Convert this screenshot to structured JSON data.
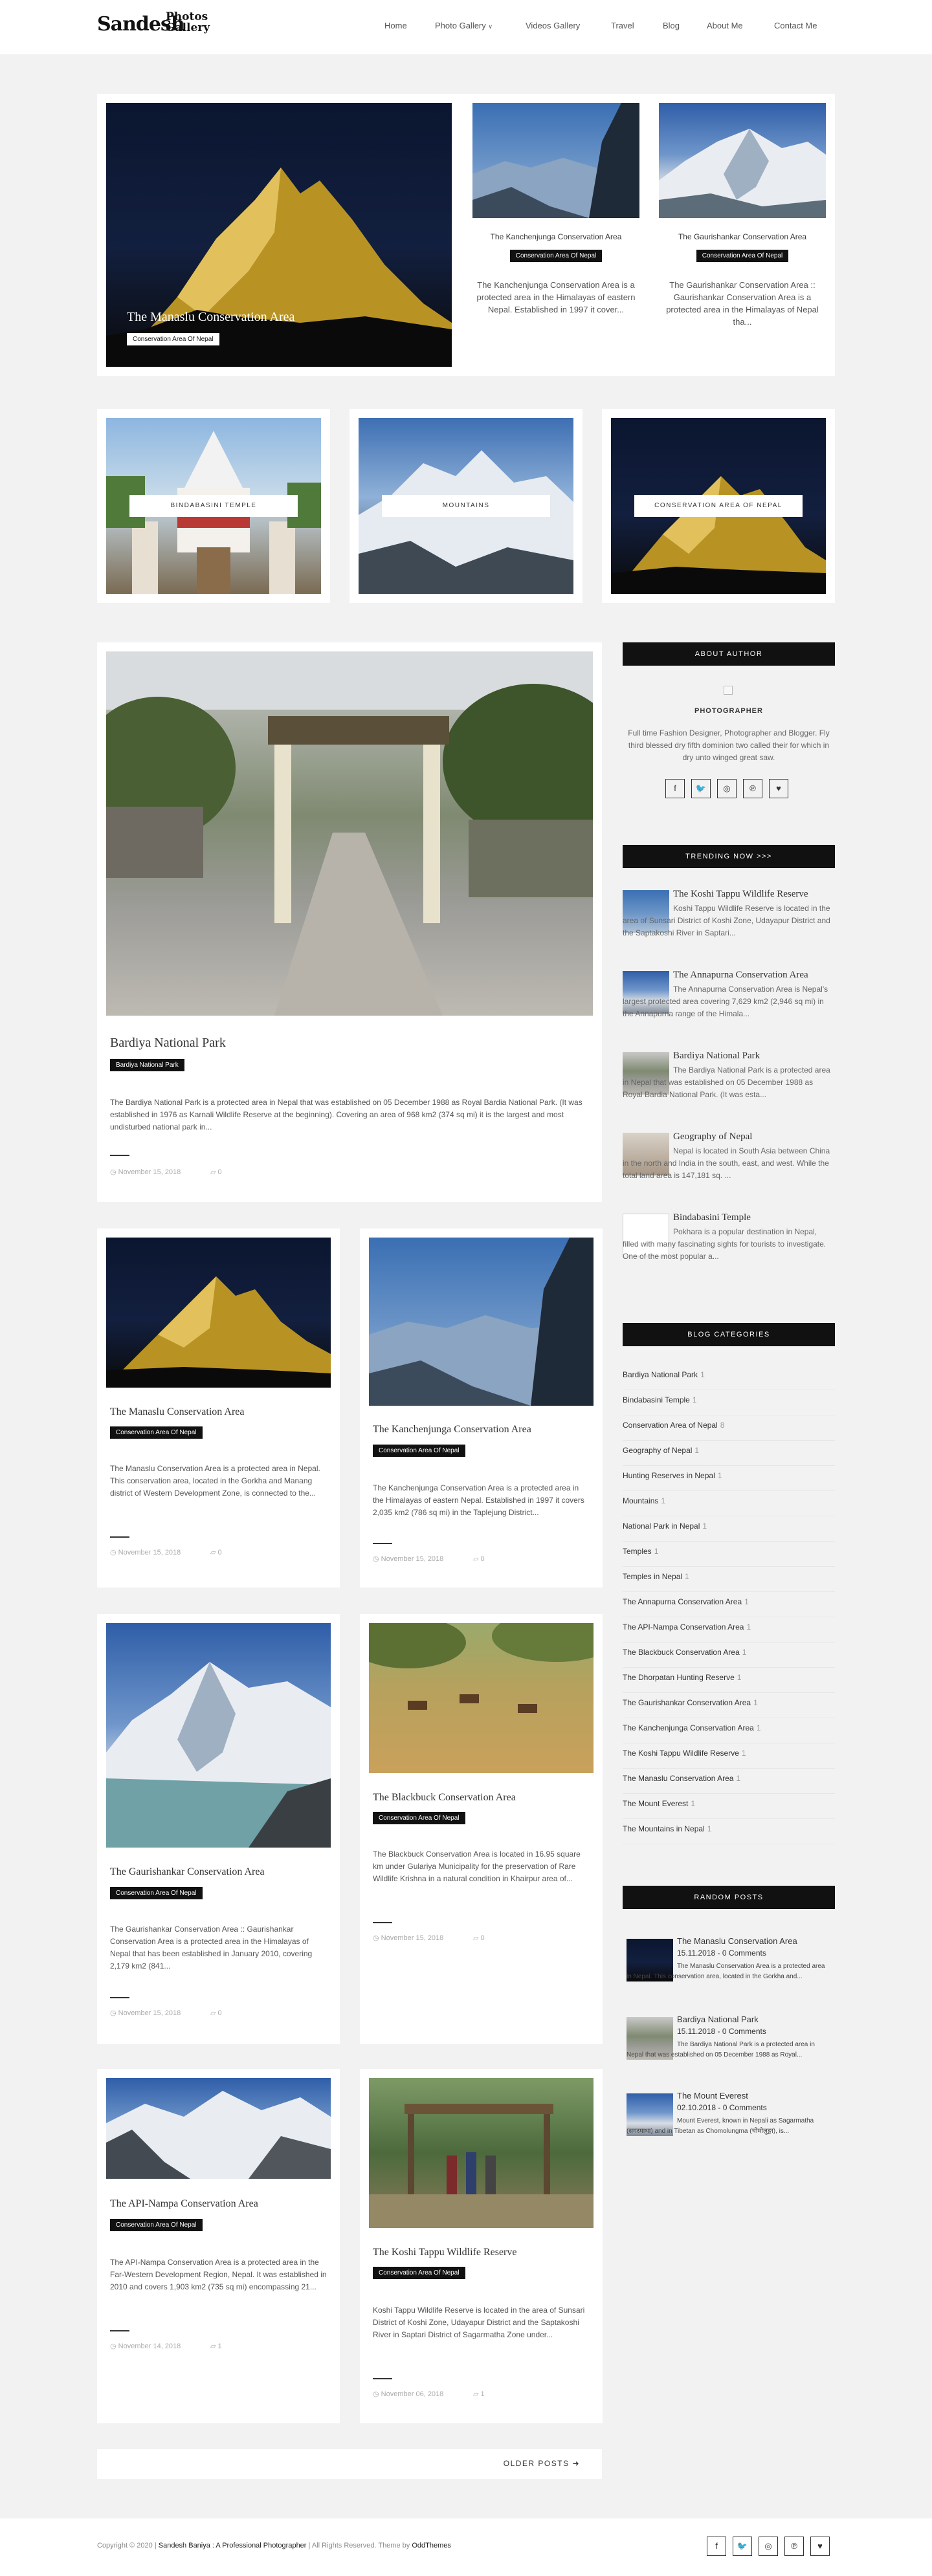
{
  "site": {
    "logo_main": "Sandesh",
    "logo_sub": "Photos\nGallery",
    "nav": [
      "Home",
      "Photo Gallery",
      "Videos Gallery",
      "Travel",
      "Blog",
      "About Me",
      "Contact Me"
    ],
    "dropdown_caret": "∨"
  },
  "featured": {
    "big": {
      "title": "The Manaslu Conservation Area",
      "badge": "Conservation Area Of Nepal"
    },
    "small": [
      {
        "title": "The Kanchenjunga Conservation Area",
        "badge": "Conservation Area Of Nepal",
        "excerpt": "The Kanchenjunga Conservation Area is a protected area in the Himalayas of eastern Nepal. Established in 1997 it cover..."
      },
      {
        "title": "The Gaurishankar Conservation Area",
        "badge": "Conservation Area Of Nepal",
        "excerpt": "The Gaurishankar Conservation Area :: Gaurishankar Conservation Area is a protected area in the Himalayas of Nepal tha..."
      }
    ]
  },
  "promo": [
    {
      "label": "BINDABASINI TEMPLE"
    },
    {
      "label": "MOUNTAINS"
    },
    {
      "label": "CONSERVATION AREA OF NEPAL"
    }
  ],
  "main_post": {
    "title": "Bardiya National Park",
    "badge": "Bardiya National Park",
    "excerpt": "The Bardiya National Park is a protected area in Nepal that was established on 05 December 1988 as Royal Bardia National Park. (It was established in 1976 as Karnali Wildlife Reserve at the beginning). Covering an area of 968 km2 (374 sq mi) it is the largest and most undisturbed national park in...",
    "date": "November 15, 2018",
    "comments": "0"
  },
  "posts": [
    {
      "title": "The Manaslu Conservation Area",
      "badge": "Conservation Area Of Nepal",
      "excerpt": "The Manaslu Conservation Area is a protected area in Nepal. This conservation area, located in the Gorkha and Manang district of Western Development Zone, is connected to the...",
      "date": "November 15, 2018",
      "comments": "0"
    },
    {
      "title": "The Kanchenjunga Conservation Area",
      "badge": "Conservation Area Of Nepal",
      "excerpt": "The Kanchenjunga Conservation Area is a protected area in the Himalayas of eastern Nepal. Established in 1997 it covers 2,035 km2 (786 sq mi) in the Taplejung District...",
      "date": "November 15, 2018",
      "comments": "0"
    },
    {
      "title": "The Gaurishankar Conservation Area",
      "badge": "Conservation Area Of Nepal",
      "excerpt": "The Gaurishankar Conservation Area :: Gaurishankar Conservation Area is a protected area in the Himalayas of Nepal that has been established in January 2010, covering 2,179 km2 (841...",
      "date": "November 15, 2018",
      "comments": "0"
    },
    {
      "title": "The Blackbuck Conservation Area",
      "badge": "Conservation Area Of Nepal",
      "excerpt": "The Blackbuck Conservation Area is located in 16.95 square km under Gulariya Municipality for the preservation of Rare Wildlife Krishna in a natural condition in Khairpur area of...",
      "date": "November 15, 2018",
      "comments": "0"
    },
    {
      "title": "The API-Nampa Conservation Area",
      "badge": "Conservation Area Of Nepal",
      "excerpt": "The API-Nampa Conservation Area is a protected area in the Far-Western Development Region, Nepal. It was established in 2010 and covers 1,903 km2 (735 sq mi) encompassing 21...",
      "date": "November 14, 2018",
      "comments": "1"
    },
    {
      "title": "The Koshi Tappu Wildlife Reserve",
      "badge": "Conservation Area Of Nepal",
      "excerpt": "Koshi Tappu Wildlife Reserve is located in the area of Sunsari District of Koshi Zone, Udayapur District and the Saptakoshi River in Saptari District of Sagarmatha Zone under...",
      "date": "November 06, 2018",
      "comments": "1"
    }
  ],
  "older_posts": "OLDER POSTS ➜",
  "sidebar": {
    "about_heading": "ABOUT AUTHOR",
    "role": "PHOTOGRAPHER",
    "bio": "Full time Fashion Designer, Photographer and Blogger. Fly third blessed dry fifth dominion two called their for which in dry unto winged great saw.",
    "social_icons": [
      "facebook-icon",
      "twitter-icon",
      "instagram-icon",
      "pinterest-icon",
      "heart-icon"
    ],
    "trending_heading": "TRENDING NOW >>>",
    "trending": [
      {
        "title": "The Koshi Tappu Wildlife Reserve",
        "excerpt": "Koshi Tappu Wildlife Reserve is located in the area of Sunsari District of Koshi Zone, Udayapur District and the Saptakoshi River in Saptari..."
      },
      {
        "title": "The Annapurna Conservation Area",
        "excerpt": "The Annapurna Conservation Area is Nepal's largest protected area covering 7,629 km2 (2,946 sq mi) in the Annapurna range of the Himala..."
      },
      {
        "title": "Bardiya National Park",
        "excerpt": "The Bardiya National Park is a protected area in Nepal that was established on 05 December 1988 as Royal Bardia National Park. (It was esta..."
      },
      {
        "title": "Geography of Nepal",
        "excerpt": "Nepal is located in South Asia between China in the north and India in the south, east, and west. While the total land area is 147,181 sq. ..."
      },
      {
        "title": "Bindabasini Temple",
        "excerpt": "Pokhara is a popular destination in Nepal, filled with many fascinating sights for tourists to investigate. One of the most popular a..."
      }
    ],
    "categories_heading": "BLOG CATEGORIES",
    "categories": [
      {
        "name": "Bardiya National Park",
        "count": "1"
      },
      {
        "name": "Bindabasini Temple",
        "count": "1"
      },
      {
        "name": "Conservation Area of Nepal",
        "count": "8"
      },
      {
        "name": "Geography of Nepal",
        "count": "1"
      },
      {
        "name": "Hunting Reserves in Nepal",
        "count": "1"
      },
      {
        "name": "Mountains",
        "count": "1"
      },
      {
        "name": "National Park in Nepal",
        "count": "1"
      },
      {
        "name": "Temples",
        "count": "1"
      },
      {
        "name": "Temples in Nepal",
        "count": "1"
      },
      {
        "name": "The Annapurna Conservation Area",
        "count": "1"
      },
      {
        "name": "The API-Nampa Conservation Area",
        "count": "1"
      },
      {
        "name": "The Blackbuck Conservation Area",
        "count": "1"
      },
      {
        "name": "The Dhorpatan Hunting Reserve",
        "count": "1"
      },
      {
        "name": "The Gaurishankar Conservation Area",
        "count": "1"
      },
      {
        "name": "The Kanchenjunga Conservation Area",
        "count": "1"
      },
      {
        "name": "The Koshi Tappu Wildlife Reserve",
        "count": "1"
      },
      {
        "name": "The Manaslu Conservation Area",
        "count": "1"
      },
      {
        "name": "The Mount Everest",
        "count": "1"
      },
      {
        "name": "The Mountains in Nepal",
        "count": "1"
      }
    ],
    "random_heading": "RANDOM POSTS",
    "random": [
      {
        "title": "The Manaslu Conservation Area",
        "meta": "15.11.2018 - 0 Comments",
        "excerpt": "The Manaslu Conservation Area is a protected area in Nepal. This conservation area, located in the Gorkha and..."
      },
      {
        "title": "Bardiya National Park",
        "meta": "15.11.2018 - 0 Comments",
        "excerpt": "The Bardiya National Park is a protected area in Nepal that was established on 05 December 1988 as Royal..."
      },
      {
        "title": "The Mount Everest",
        "meta": "02.10.2018 - 0 Comments",
        "excerpt": "Mount Everest, known in Nepali as Sagarmatha (सगरमाथा) and in Tibetan as Chomolungma (चोमोलुङ्मा), is..."
      }
    ]
  },
  "footer": {
    "copyright": "Copyright © 2020 |",
    "author": "Sandesh Baniya : A Professional Photographer",
    "rights": "| All Rights Reserved. Theme by",
    "theme": "OddThemes"
  },
  "colors": {
    "accent": "#111111",
    "page_bg": "#f2f2f2"
  }
}
